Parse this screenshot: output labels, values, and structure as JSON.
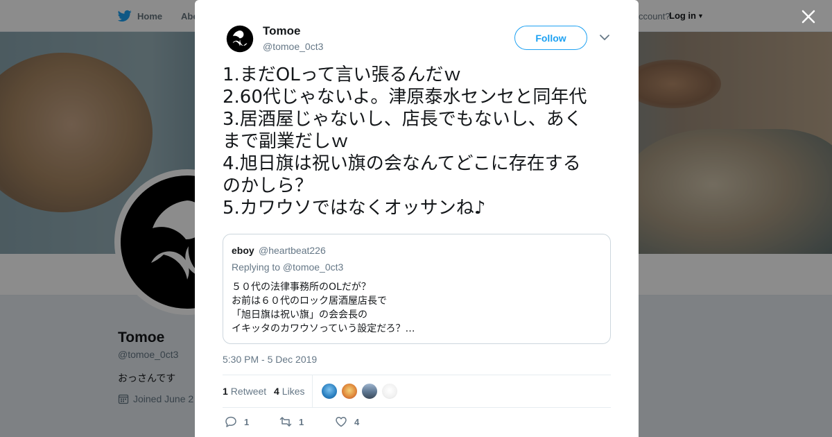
{
  "colors": {
    "accent": "#1da1f2",
    "text_primary": "#14171a",
    "text_secondary": "#657786",
    "border": "#e6ecf0"
  },
  "background_page": {
    "nav": {
      "home_label": "Home",
      "about_label": "Abo",
      "account_prompt": "ccount?",
      "login_label": "Log in"
    },
    "profile": {
      "name": "Tomoe",
      "handle": "@tomoe_0ct3",
      "bio": "おっさんです",
      "joined": "Joined June 2"
    }
  },
  "modal": {
    "author": {
      "name": "Tomoe",
      "handle": "@tomoe_0ct3",
      "avatar_icon": "tomoe-crest-icon"
    },
    "follow_label": "Follow",
    "tweet_lines": [
      "1.まだOLって言い張るんだｗ",
      "2.60代じゃないよ。津原泰水センセと同年代",
      "3.居酒屋じゃないし、店長でもないし、あく",
      "まで副業だしｗ",
      "4.旭日旗は祝い旗の会なんてどこに存在する",
      "のかしら？",
      "5.カワウソではなくオッサンね♪"
    ],
    "quoted": {
      "name": "eboy",
      "handle": "@heartbeat226",
      "replying_to": "Replying to @tomoe_0ct3",
      "lines": [
        "５０代の法律事務所のOLだが？",
        "お前は６０代のロック居酒屋店長で",
        "「旭日旗は祝い旗」の会会長の",
        "イキッタのカワウソっていう設定だろ？…"
      ]
    },
    "timestamp": "5:30 PM - 5 Dec 2019",
    "stats": {
      "retweet_count": "1",
      "retweet_label": "Retweet",
      "like_count": "4",
      "like_label": "Likes"
    },
    "actions": {
      "reply_count": "1",
      "retweet_count": "1",
      "like_count": "4"
    }
  }
}
